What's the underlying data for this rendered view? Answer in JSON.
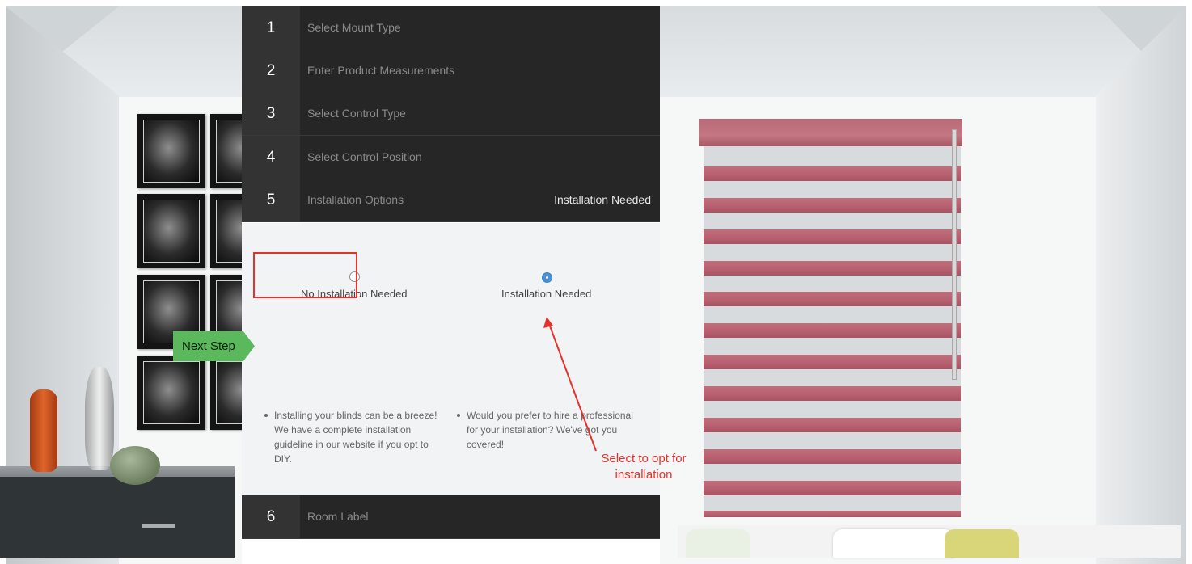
{
  "steps": [
    {
      "number": "1",
      "label": "Select Mount Type",
      "value": ""
    },
    {
      "number": "2",
      "label": "Enter Product Measurements",
      "value": ""
    },
    {
      "number": "3",
      "label": "Select Control Type",
      "value": ""
    },
    {
      "number": "4",
      "label": "Select Control Position",
      "value": ""
    },
    {
      "number": "5",
      "label": "Installation Options",
      "value": "Installation Needed"
    },
    {
      "number": "6",
      "label": "Room Label",
      "value": ""
    }
  ],
  "installation": {
    "options": [
      {
        "label": "No Installation Needed",
        "selected": false
      },
      {
        "label": "Installation Needed",
        "selected": true
      }
    ],
    "next_label": "Next Step",
    "info": [
      "Installing your blinds can be a breeze! We have a complete installation guideline in our website if you opt to DIY.",
      "Would you prefer to hire a professional for your installation? We've got you covered!"
    ]
  },
  "annotation": {
    "line1": "Select to opt for",
    "line2": "installation",
    "color": "#e3322b"
  },
  "colors": {
    "panel_dark": "#262626",
    "button_green": "#5cb85c",
    "radio_selected": "#4a90d9",
    "blind": "#c06f7c"
  }
}
